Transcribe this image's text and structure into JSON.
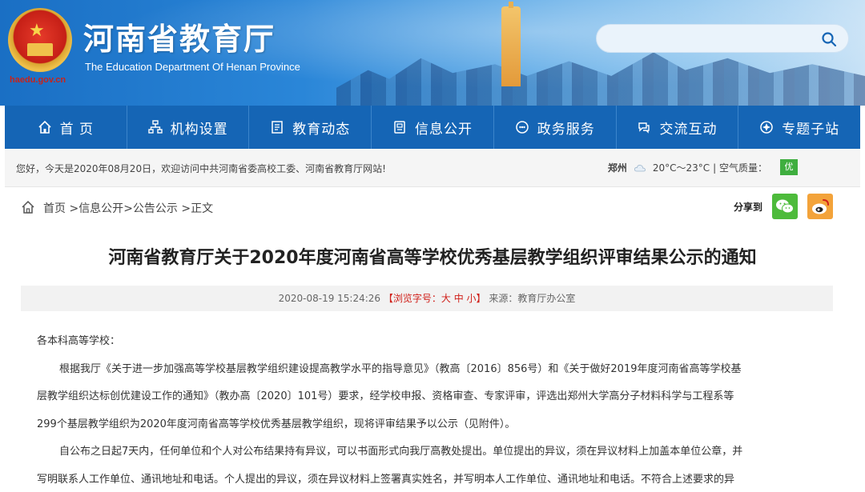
{
  "header": {
    "site_title": "河南省教育厅",
    "site_subtitle": "The Education Department Of Henan Province",
    "site_url": "haedu.gov.cn",
    "search_placeholder": ""
  },
  "nav": {
    "items": [
      {
        "label": "首 页",
        "icon": "home-icon"
      },
      {
        "label": "机构设置",
        "icon": "org-chart-icon"
      },
      {
        "label": "教育动态",
        "icon": "news-icon"
      },
      {
        "label": "信息公开",
        "icon": "document-icon"
      },
      {
        "label": "政务服务",
        "icon": "service-icon"
      },
      {
        "label": "交流互动",
        "icon": "interaction-icon"
      },
      {
        "label": "专题子站",
        "icon": "topic-icon"
      }
    ]
  },
  "infobar": {
    "welcome": "您好，今天是2020年08月20日，欢迎访问中共河南省委高校工委、河南省教育厅网站!",
    "city": "郑州",
    "temperature": "20°C～23°C",
    "air_quality_label": "| 空气质量：",
    "air_quality_value": "优"
  },
  "breadcrumb": {
    "home": "首页",
    "sep1": " >",
    "item1": "信息公开",
    "sep2": ">",
    "item2": "公告公示",
    "sep3": " >",
    "item3": "正文",
    "share_label": "分享到"
  },
  "article": {
    "title": "河南省教育厅关于2020年度河南省高等学校优秀基层教学组织评审结果公示的通知",
    "date": "2020-08-19 15:24:26",
    "font_size_label": "【浏览字号：大 中 小】",
    "source": "来源：教育厅办公室",
    "salutation": "各本科高等学校：",
    "para1_line1": "根据我厅《关于进一步加强高等学校基层教学组织建设提高教学水平的指导意见》（教高〔2016〕856号）和《关于做好2019年度河南省高等学校基",
    "para1_line2": "层教学组织达标创优建设工作的通知》（教办高〔2020〕101号）要求，经学校申报、资格审查、专家评审，评选出郑州大学高分子材料科学与工程系等",
    "para1_line3": "299个基层教学组织为2020年度河南省高等学校优秀基层教学组织，现将评审结果予以公示（见附件）。",
    "para2_line1": "自公布之日起7天内，任何单位和个人对公布结果持有异议，可以书面形式向我厅高教处提出。单位提出的异议，须在异议材料上加盖本单位公章，并",
    "para2_line2": "写明联系人工作单位、通讯地址和电话。个人提出的异议，须在异议材料上签署真实姓名，并写明本人工作单位、通讯地址和电话。不符合上述要求的异"
  }
}
